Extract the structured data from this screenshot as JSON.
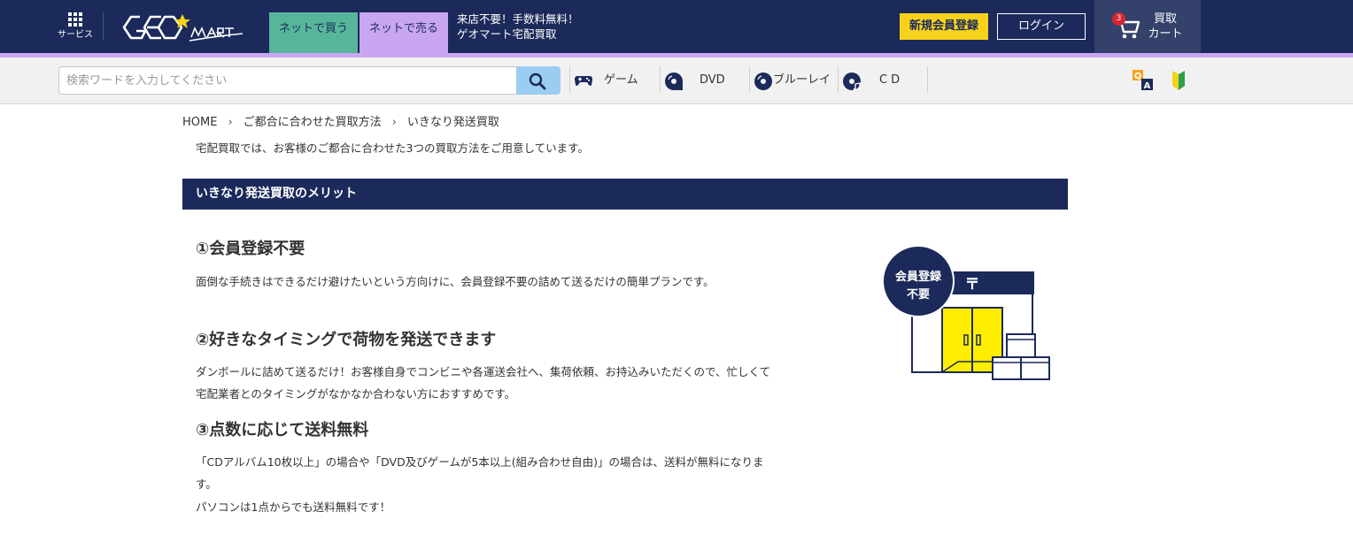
{
  "header": {
    "services_label": "サービス",
    "tab_buy": "ネットで買う",
    "tab_sell": "ネットで売る",
    "promo_line1": "来店不要！手数料無料！",
    "promo_line2": "ゲオマート宅配買取",
    "register_button": "新規会員登録",
    "login_button": "ログイン",
    "cart_badge": "3",
    "cart_line1": "買取",
    "cart_line2": "カート"
  },
  "search": {
    "placeholder": "検索ワードを入力してください",
    "categories": [
      {
        "label": "ゲーム",
        "icon": "gamepad-icon"
      },
      {
        "label": "DVD",
        "icon": "disc-icon"
      },
      {
        "label": "ブルーレイ",
        "icon": "bluray-disc-icon"
      },
      {
        "label": "CD",
        "icon": "cd-music-icon"
      }
    ]
  },
  "breadcrumb": [
    "HOME",
    "ご都合に合わせた買取方法",
    "いきなり発送買取"
  ],
  "intro": "宅配買取では、お客様のご都合に合わせた3つの買取方法をご用意しています。",
  "section": {
    "title": "いきなり発送買取のメリット",
    "merits": [
      {
        "title": "①会員登録不要",
        "text": "面倒な手続きはできるだけ避けたいという方向けに、会員登録不要の詰めて送るだけの簡単プランです。"
      },
      {
        "title": "②好きなタイミングで荷物を発送できます",
        "text": "ダンボールに詰めて送るだけ！お客様自身でコンビニや各運送会社へ、集荷依頼、お持込みいただくので、忙しくて宅配業者とのタイミングがなかなか合わない方におすすめです。"
      },
      {
        "title": "③点数に応じて送料無料",
        "text": "「CDアルバム10枚以上」の場合や「DVD及びゲームが5本以上(組み合わせ自由)」の場合は、送料が無料になります。",
        "text2": "パソコンは1点からでも送料無料です！"
      }
    ],
    "illustration_badge_line1": "会員登録",
    "illustration_badge_line2": "不要",
    "illustration_post_mark": "〒"
  },
  "colors": {
    "navy": "#1b2a5a",
    "buy_green": "#57b69a",
    "sell_purple": "#c8a6f2",
    "register_yellow": "#f7d21b",
    "search_blue": "#9bcdf3",
    "badge_red": "#d7262e",
    "illustration_yellow": "#ffee00"
  }
}
